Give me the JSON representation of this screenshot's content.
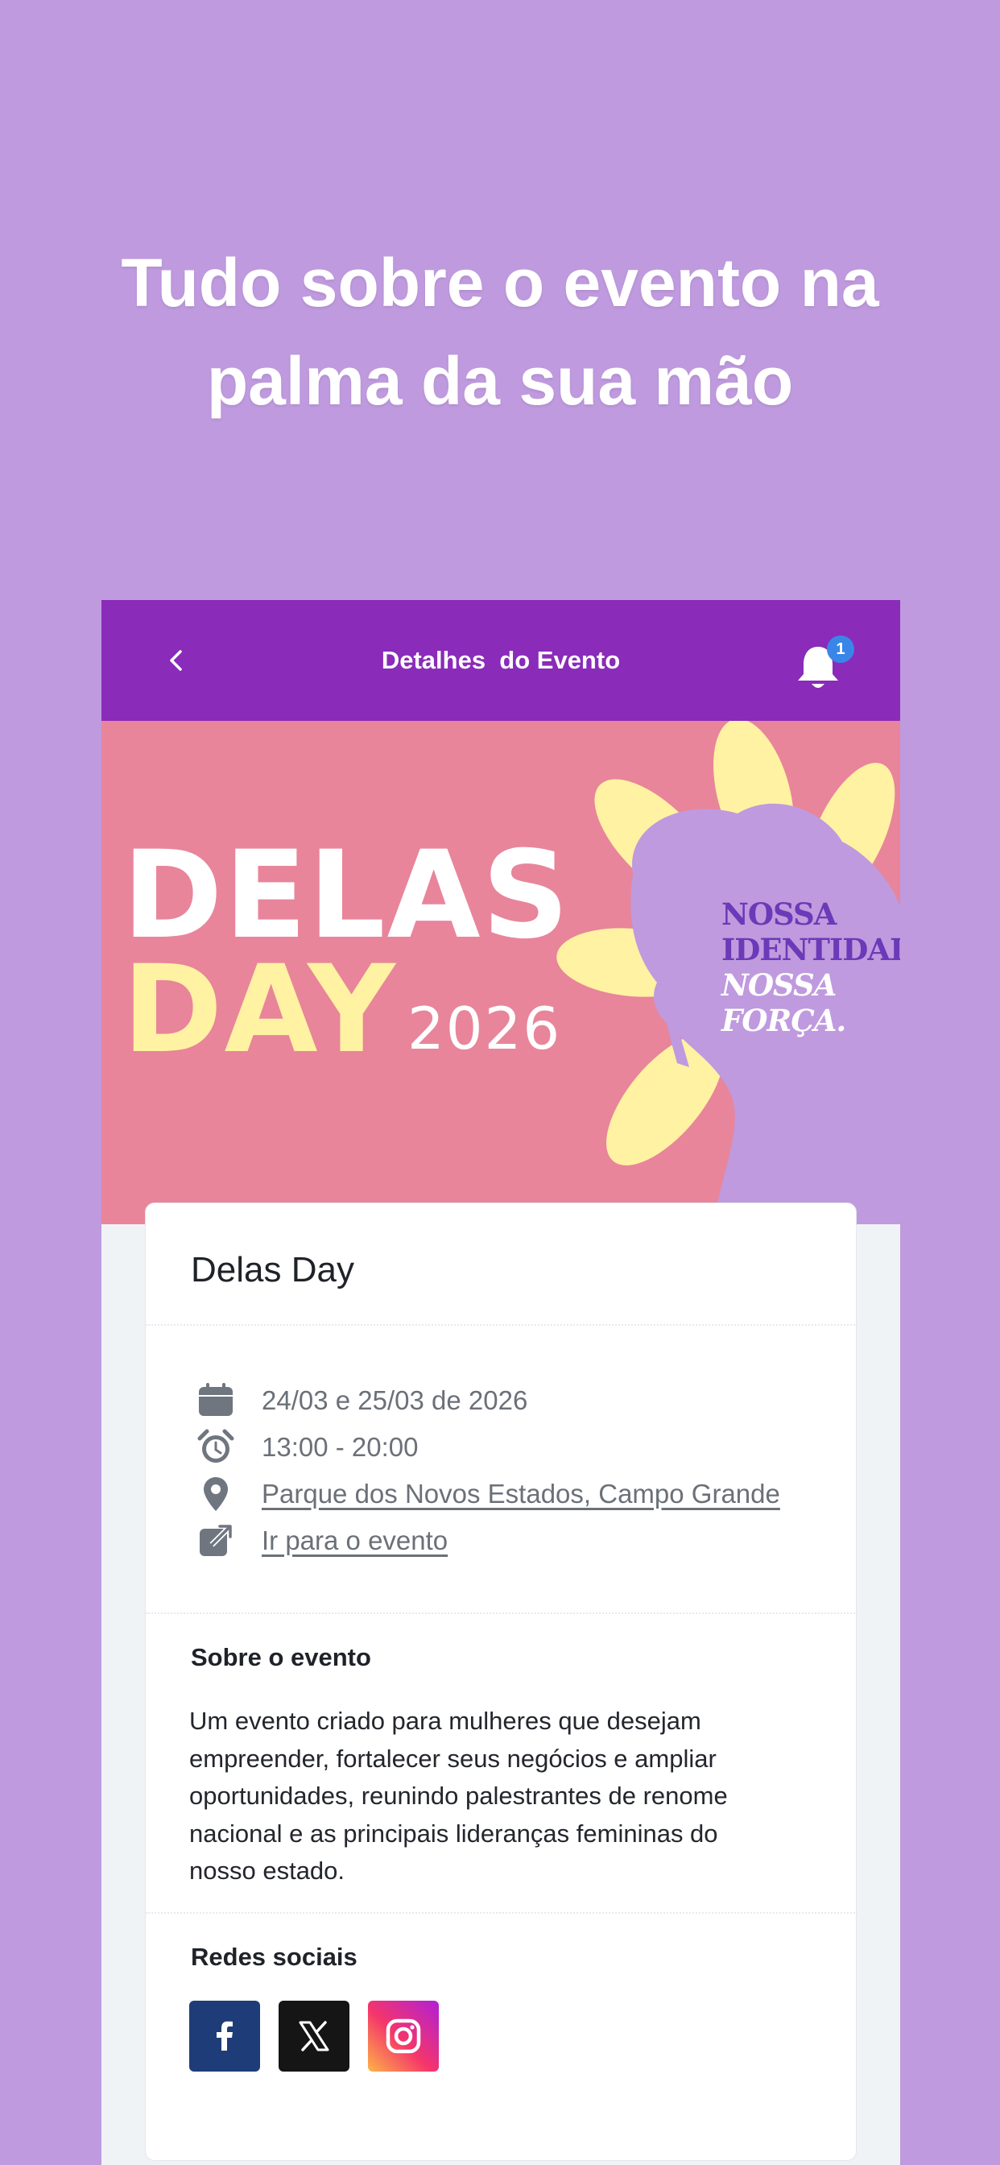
{
  "headline": {
    "line1": "Tudo sobre o evento na",
    "line2": "palma da sua mão"
  },
  "appbar": {
    "title": "Detalhes  do Evento",
    "back_icon": "chevron-left-icon",
    "notification_icon": "bell-icon",
    "notification_count": "1",
    "color": "#8a2bb9"
  },
  "banner": {
    "word1": "DELAS",
    "word2": "DAY",
    "year": "2026",
    "slogan_line1": "NOSSA",
    "slogan_line2": "IDENTIDADE.",
    "slogan_line3": "NOSSA",
    "slogan_line4": "FORÇA.",
    "background_color": "#e8859a",
    "flower_color": "#fff2a2",
    "silhouette_color": "#bf9ade"
  },
  "event": {
    "title": "Delas Day",
    "date": "24/03 e 25/03 de 2026",
    "time": "13:00 - 20:00",
    "location": "Parque dos Novos Estados, Campo Grande ",
    "link": "Ir para o evento",
    "date_icon": "calendar-icon",
    "time_icon": "alarm-clock-icon",
    "location_icon": "map-pin-icon",
    "link_icon": "external-link-icon"
  },
  "about": {
    "heading": "Sobre o evento",
    "line1": "Um evento criado para mulheres que desejam",
    "line2": "empreender, fortalecer seus negócios e ampliar",
    "line3": "oportunidades, reunindo palestrantes de renome",
    "line4": "nacional e as principais lideranças femininas do",
    "line5": "nosso estado."
  },
  "social": {
    "heading": "Redes sociais",
    "items": [
      {
        "icon": "facebook-icon",
        "color": "#1e3c78"
      },
      {
        "icon": "x-icon",
        "color": "#151515"
      },
      {
        "icon": "instagram-icon",
        "color": "#e1306c"
      }
    ]
  }
}
